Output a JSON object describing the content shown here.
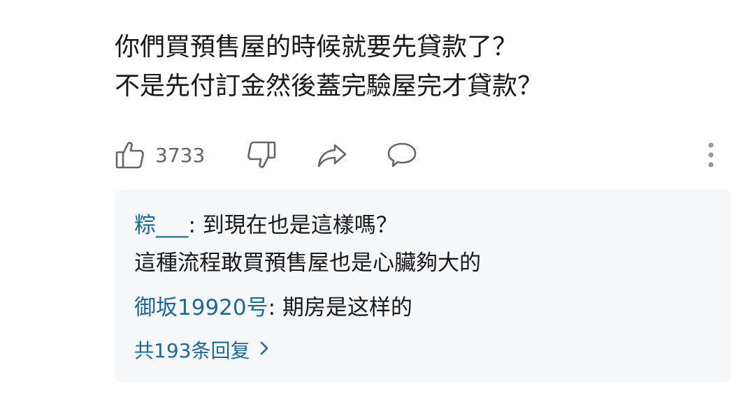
{
  "comment": {
    "lines": [
      "你們買預售屋的時候就要先貸款了？",
      "不是先付訂金然後蓋完驗屋完才貸款？"
    ],
    "like_count": "3733",
    "icons": {
      "like": "thumbs-up-icon",
      "dislike": "thumbs-down-icon",
      "share": "share-icon",
      "reply": "reply-bubble-icon",
      "more": "more-vertical-icon"
    }
  },
  "replies": {
    "items": [
      {
        "author": "粽___",
        "text": ": 到現在也是這樣嗎？",
        "continuation": "這種流程敢買預售屋也是心臟夠大的"
      },
      {
        "author": "御坂19920号",
        "text": ": 期房是这样的"
      }
    ],
    "more_label": "共193条回复"
  },
  "colors": {
    "text": "#18191c",
    "secondary": "#61666d",
    "link": "#1b6a94",
    "reply_bg": "#f6f7f8",
    "icon": "#61666d"
  }
}
